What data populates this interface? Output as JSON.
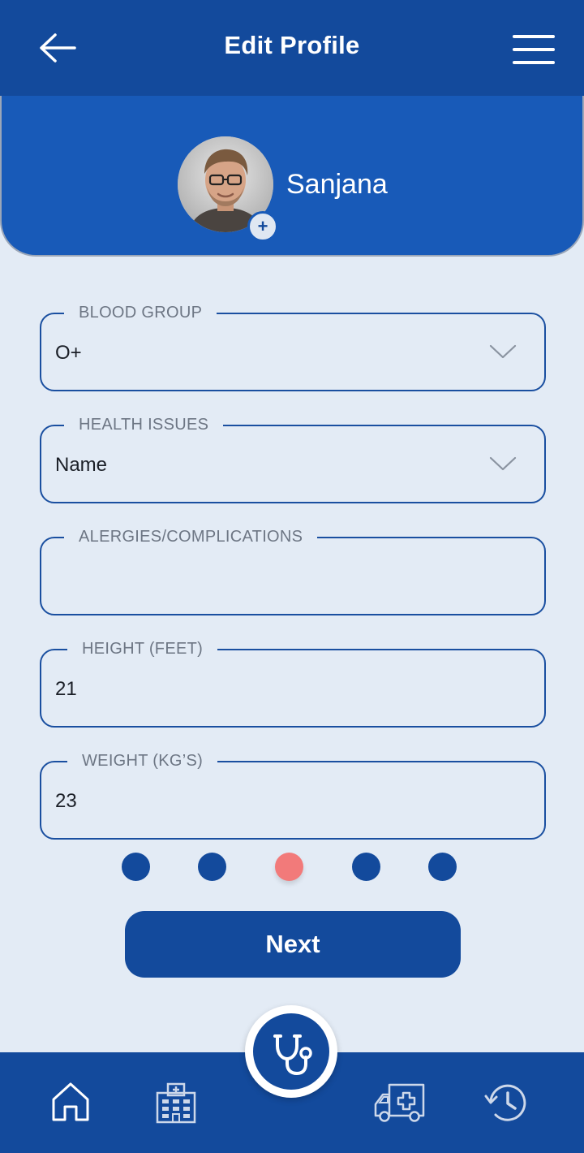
{
  "header": {
    "title": "Edit Profile",
    "back_icon": "arrow-left-icon",
    "menu_icon": "hamburger-menu-icon"
  },
  "profile": {
    "name": "Sanjana",
    "avatar_icon": "user-avatar-photo",
    "add_photo_icon": "plus-icon",
    "add_symbol": "+"
  },
  "form": {
    "blood_group": {
      "label": "BLOOD GROUP",
      "value": "O+"
    },
    "health_issues": {
      "label": "HEALTH ISSUES",
      "value": "Name"
    },
    "allergies": {
      "label": "ALERGIES/COMPLICATIONS",
      "value": ""
    },
    "height": {
      "label": "HEIGHT (FEET)",
      "value": "21"
    },
    "weight": {
      "label": "WEIGHT (KG’S)",
      "value": "23"
    }
  },
  "pagination": {
    "total": 5,
    "current": 3
  },
  "next_button": {
    "label": "Next"
  },
  "bottom_nav": {
    "items": [
      "home-icon",
      "hospital-icon",
      "stethoscope-icon",
      "ambulance-icon",
      "history-icon"
    ]
  },
  "colors": {
    "primary": "#134a9c",
    "panel": "#185ab8",
    "background": "#e3ebf5",
    "accent": "#f27a7a"
  }
}
